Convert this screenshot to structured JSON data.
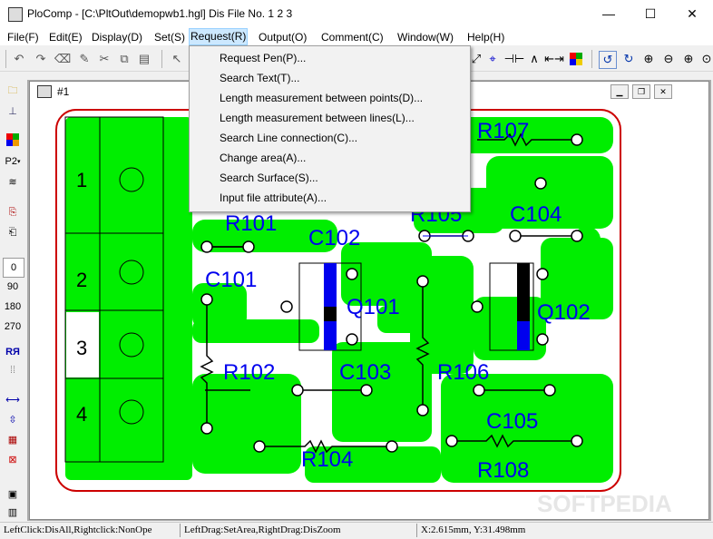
{
  "window": {
    "title": "PloComp - [C:\\PltOut\\demopwb1.hgl] Dis File No. 1 2 3",
    "minimize": "—",
    "maximize": "☐",
    "close": "✕"
  },
  "menu": [
    "File(F)",
    "Edit(E)",
    "Display(D)",
    "Set(S)",
    "Request(R)",
    "Output(O)",
    "Comment(C)",
    "Window(W)",
    "Help(H)"
  ],
  "request_menu": [
    "Request Pen(P)...",
    "Search Text(T)...",
    "Length measurement between points(D)...",
    "Length measurement between lines(L)...",
    "Search Line connection(C)...",
    "Change area(A)...",
    "Search Surface(S)...",
    "Input file attribute(A)..."
  ],
  "left_tools": {
    "pen": "P2",
    "angle_0": "0",
    "angle_90": "90",
    "angle_180": "180",
    "angle_270": "270"
  },
  "child": {
    "title": "#1"
  },
  "pcb": {
    "pads": [
      "1",
      "2",
      "3",
      "4"
    ],
    "labels": [
      "R107",
      "R101",
      "R105",
      "C104",
      "C102",
      "C101",
      "Q101",
      "Q102",
      "R102",
      "C103",
      "R106",
      "C105",
      "R104",
      "R108"
    ],
    "colors": {
      "copper": "#00ee00",
      "outline": "#cc0000",
      "label": "#0000ee",
      "mask": "#0000ee"
    }
  },
  "status": {
    "left": "LeftClick:DisAll,Rightclick:NonOpe",
    "drag": "LeftDrag:SetArea,RightDrag:DisZoom",
    "coords": "X:2.615mm, Y:31.498mm"
  },
  "watermark": "SOFTPEDIA"
}
